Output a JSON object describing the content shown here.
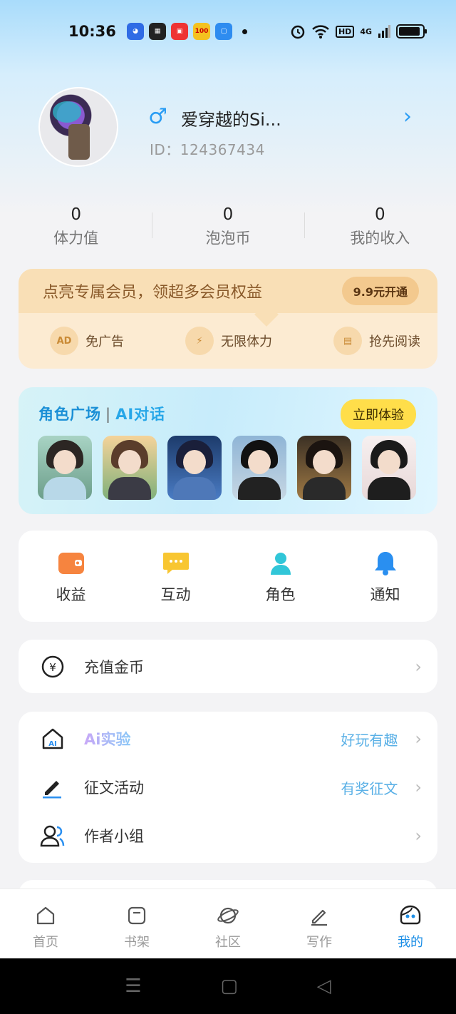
{
  "status": {
    "time": "10:36",
    "hd": "HD",
    "net": "4G",
    "battery_level": 0.9
  },
  "profile": {
    "name": "爱穿越的Si...",
    "id": "ID：124367434",
    "gender_symbol": "♂",
    "arrow": "›"
  },
  "stats": [
    {
      "value": "0",
      "label": "体力值"
    },
    {
      "value": "0",
      "label": "泡泡币"
    },
    {
      "value": "0",
      "label": "我的收入"
    }
  ],
  "vip": {
    "title": "点亮专属会员，领超多会员权益",
    "button": "9.9元开通",
    "perks": [
      {
        "icon_text": "AD",
        "label": "免广告"
      },
      {
        "icon_text": "⚡",
        "label": "无限体力"
      },
      {
        "icon_text": "▤",
        "label": "抢先阅读"
      }
    ]
  },
  "roles": {
    "title_a": "角色广场",
    "title_b": "AI对话",
    "sep": "|",
    "button": "立即体验"
  },
  "grid": [
    {
      "label": "收益"
    },
    {
      "label": "互动"
    },
    {
      "label": "角色"
    },
    {
      "label": "通知"
    }
  ],
  "recharge": {
    "label": "充值金币"
  },
  "list": [
    {
      "label": "Ai实验",
      "value": "好玩有趣"
    },
    {
      "label": "征文活动",
      "value": "有奖征文"
    },
    {
      "label": "作者小组",
      "value": ""
    }
  ],
  "arrow": "›",
  "nav": [
    {
      "label": "首页"
    },
    {
      "label": "书架"
    },
    {
      "label": "社区"
    },
    {
      "label": "写作"
    },
    {
      "label": "我的"
    }
  ],
  "colors": {
    "accent": "#1b8ee6",
    "vip_bg": "#fcebd2",
    "roles_btn": "#ffde4a"
  }
}
